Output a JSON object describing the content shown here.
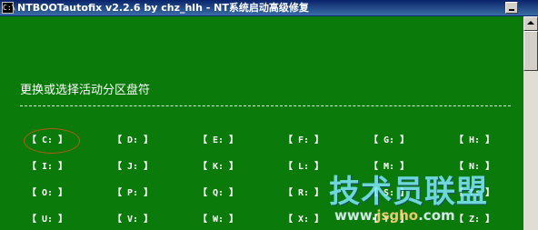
{
  "window": {
    "title": "NTBOOTautofix v2.2.6 by chz_hlh - NT系统启动高级修复",
    "icon": "C:\\"
  },
  "content": {
    "heading": "更换或选择活动分区盘符",
    "separator": "------------------------------------------------------------------------------------------------",
    "drives": [
      [
        "C:",
        "D:",
        "E:",
        "F:",
        "G:",
        "H:"
      ],
      [
        "I:",
        "J:",
        "K:",
        "L:",
        "M:",
        "N:"
      ],
      [
        "O:",
        "P:",
        "Q:",
        "R:",
        "S:",
        "T:"
      ],
      [
        "U:",
        "V:",
        "W:",
        "X:",
        "Y:",
        "Z:"
      ]
    ],
    "bracket_open": "【",
    "bracket_close": "】",
    "highlighted_drive": "C:"
  },
  "watermark": {
    "text": "技术员联盟",
    "url_prefix": "www.",
    "url_domain": "jsgho",
    "url_suffix": ".com"
  },
  "colors": {
    "console_bg": "#0a7a0a",
    "highlight_ring": "#b55a1a"
  }
}
